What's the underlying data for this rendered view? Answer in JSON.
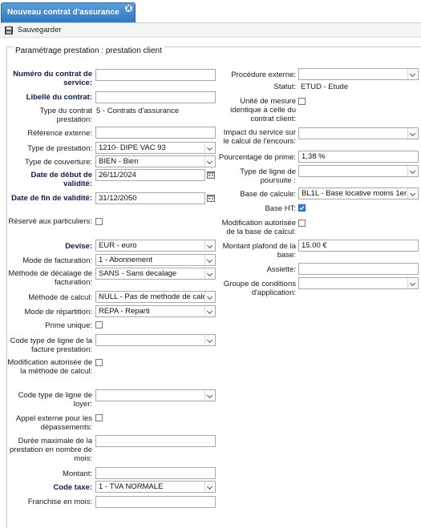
{
  "tab": {
    "title": "Nouveau contrat d'assurance",
    "close": "X"
  },
  "toolbar": {
    "save_label": "Sauvegarder"
  },
  "section": {
    "legend": "Paramétrage prestation : prestation client"
  },
  "left": {
    "numero_label": "Numéro du contrat de service:",
    "numero_value": "",
    "libelle_label": "Libellé du contrat:",
    "libelle_value": "",
    "type_contrat_label": "Type du contrat prestation:",
    "type_contrat_value": "5 - Contrats d'assurance",
    "reference_label": "Référence externe:",
    "reference_value": "",
    "type_prestation_label": "Type de prestation:",
    "type_prestation_value": "1210- DIPE VAC 93",
    "type_couverture_label": "Type de couverture:",
    "type_couverture_value": "BIEN - Bien",
    "date_debut_label": "Date de début de validité:",
    "date_debut_value": "26/11/2024",
    "date_fin_label": "Date de fin de validité:",
    "date_fin_value": "31/12/2050",
    "reserve_label": "Réservé aux particuliers:",
    "devise_label": "Devise:",
    "devise_value": "EUR - euro",
    "mode_facturation_label": "Mode de facturation:",
    "mode_facturation_value": "1 - Abonnement",
    "methode_decalage_label": "Méthode de décalage de facturation:",
    "methode_decalage_value": "SANS - Sans decalage",
    "methode_calcul_label": "Méthode de calcul:",
    "methode_calcul_value": "NULL - Pas de methode de calcul",
    "mode_repartition_label": "Mode de répartition:",
    "mode_repartition_value": "REPA - Reparti",
    "prime_unique_label": "Prime unique:",
    "code_ligne_facture_label": "Code type de ligne de la facture prestation:",
    "code_ligne_facture_value": "",
    "modif_methode_label": "Modification autorisée de la méthode de calcul:",
    "code_ligne_loyer_label": "Code type de ligne de loyer:",
    "code_ligne_loyer_value": "",
    "appel_externe_label": "Appel externe pour les dépassements:",
    "duree_max_label": "Durée maximale de la prestation en nombre de mois:",
    "duree_max_value": "",
    "montant_label": "Montant:",
    "montant_value": "",
    "code_taxe_label": "Code taxe:",
    "code_taxe_value": "1 - TVA NORMALE",
    "franchise_label": "Franchise en mois:",
    "franchise_value": ""
  },
  "right": {
    "procedure_label": "Procédure externe:",
    "procedure_value": "",
    "statut_label": "Statut:",
    "statut_value": "ETUD - Etude",
    "unite_mesure_label": "Unité de mesure identique à celle du contrat client:",
    "impact_label": "Impact du service sur le calcul de l'encours:",
    "impact_value": "",
    "pourcentage_label": "Pourcentage de prime:",
    "pourcentage_value": "1,38 %",
    "type_ligne_poursuite_label": "Type de ligne de poursuite :",
    "type_ligne_poursuite_value": "",
    "base_calcul_label": "Base de calcule:",
    "base_calcul_value": "BL1L - Base locative moins 1er loyer",
    "base_ht_label": "Base HT:",
    "modif_base_label": "Modification autorisée de la base de calcul:",
    "montant_plafond_label": "Montant plafond de la base:",
    "montant_plafond_value": "15.00 €",
    "assiette_label": "Assiette:",
    "assiette_value": "",
    "groupe_conditions_label": "Groupe de conditions d'application:",
    "groupe_conditions_value": ""
  },
  "state": {
    "base_ht_checked": true
  },
  "colors": {
    "tab_gradient_top": "#5b9fdc",
    "tab_gradient_bottom": "#2f77c2",
    "label_bold": "#0d1b4f",
    "checkbox_checked": "#2a7de1"
  },
  "icons": {
    "save": "save-icon",
    "calendar": "calendar-icon",
    "dropdown": "chevron-down-icon",
    "close": "close-icon"
  }
}
